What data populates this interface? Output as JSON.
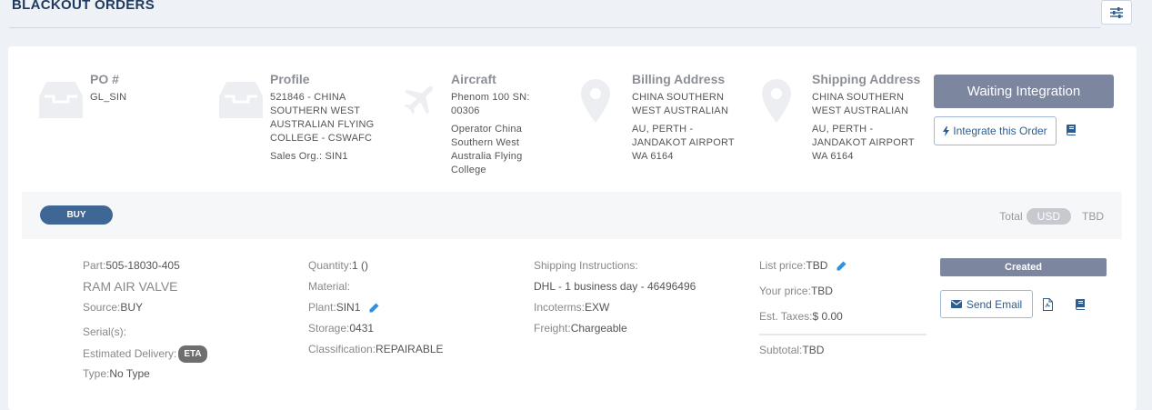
{
  "page": {
    "title": "BLACKOUT ORDERS",
    "filter_icon": "sliders-icon"
  },
  "header": {
    "po": {
      "title": "PO #",
      "value": "GL_SIN"
    },
    "profile": {
      "title": "Profile",
      "lines": [
        "521846 - CHINA",
        "SOUTHERN WEST",
        "AUSTRALIAN FLYING",
        "COLLEGE - CSWAFC"
      ],
      "sales_org": "Sales Org.: SIN1"
    },
    "aircraft": {
      "title": "Aircraft",
      "lines": [
        "Phenom 100 SN:",
        "00306"
      ],
      "operator_lines": [
        "Operator China",
        "Southern West",
        "Australia Flying",
        "College"
      ]
    },
    "billing": {
      "title": "Billing Address",
      "name_lines": [
        "CHINA SOUTHERN",
        "WEST AUSTRALIAN"
      ],
      "addr_lines": [
        "AU, PERTH -",
        "JANDAKOT AIRPORT",
        "WA 6164"
      ]
    },
    "shipping": {
      "title": "Shipping Address",
      "name_lines": [
        "CHINA SOUTHERN",
        "WEST AUSTRALIAN"
      ],
      "addr_lines": [
        "AU, PERTH -",
        "JANDAKOT AIRPORT",
        "WA 6164"
      ]
    },
    "status_label": "Waiting Integration",
    "integrate_label": "Integrate this Order"
  },
  "buy_bar": {
    "pill": "BUY",
    "total_label": "Total",
    "currency": "USD",
    "total_value": "TBD"
  },
  "item": {
    "part_label": "Part:",
    "part_value": "505-18030-405",
    "name": "RAM AIR VALVE",
    "source_label": "Source:",
    "source_value": "BUY",
    "serial_label": "Serial(s):",
    "delivery_label": "Estimated Delivery:",
    "eta": "ETA",
    "type_label": "Type:",
    "type_value": "No Type",
    "quantity_label": "Quantity:",
    "quantity_value": "1 ()",
    "material_label": "Material:",
    "plant_label": "Plant:",
    "plant_value": "SIN1",
    "storage_label": "Storage:",
    "storage_value": "0431",
    "classification_label": "Classification:",
    "classification_value": "REPAIRABLE",
    "shipping_label": "Shipping Instructions:",
    "shipping_value": "DHL - 1 business day - 46496496",
    "incoterms_label": "Incoterms:",
    "incoterms_value": "EXW",
    "freight_label": "Freight:",
    "freight_value": "Chargeable",
    "list_price_label": "List price:",
    "list_price_value": "TBD",
    "your_price_label": "Your price:",
    "your_price_value": "TBD",
    "taxes_label": "Est. Taxes:",
    "taxes_value": "$ 0.00",
    "subtotal_label": "Subtotal:",
    "subtotal_value": "TBD",
    "status": "Created",
    "send_email_label": "Send Email"
  },
  "colors": {
    "accent": "#3f6796",
    "status": "#7c869f",
    "link": "#2f5d8f",
    "edit_icon": "#2f8fe0"
  }
}
